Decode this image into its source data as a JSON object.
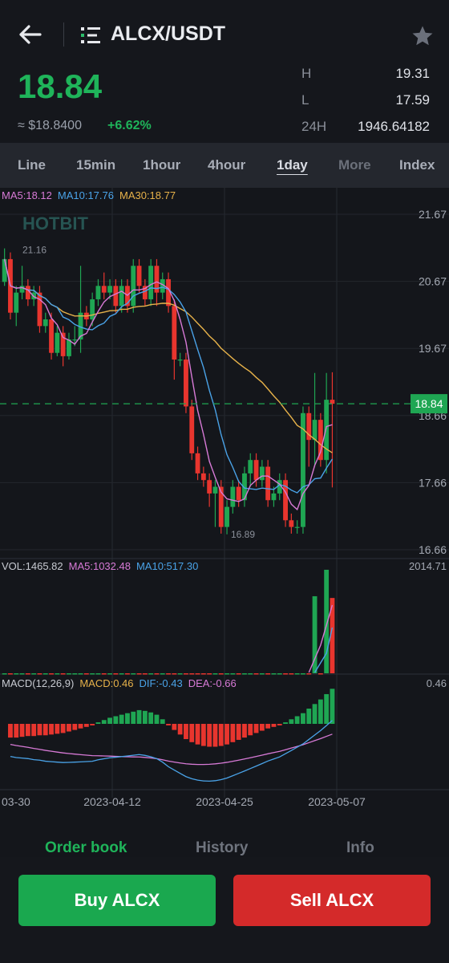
{
  "header": {
    "pair": "ALCX/USDT",
    "price": "18.84",
    "approx_usd": "≈ $18.8400",
    "change": "+6.62%",
    "stats": [
      {
        "label": "H",
        "value": "19.31"
      },
      {
        "label": "L",
        "value": "17.59"
      },
      {
        "label": "24H",
        "value": "1946.64182"
      }
    ]
  },
  "tabs": [
    {
      "label": "Line",
      "state": "normal"
    },
    {
      "label": "15min",
      "state": "normal"
    },
    {
      "label": "1hour",
      "state": "normal"
    },
    {
      "label": "4hour",
      "state": "normal"
    },
    {
      "label": "1day",
      "state": "active"
    },
    {
      "label": "More",
      "state": "dim"
    },
    {
      "label": "Index",
      "state": "normal"
    }
  ],
  "colors": {
    "up": "#1fa653",
    "down": "#e8352e",
    "ma5": "#d77ad6",
    "ma10": "#4aa3e8",
    "ma30": "#e7b24a",
    "accent": "#1fb45a"
  },
  "chart_data": {
    "type": "candlestick",
    "watermark": "HOTBIT",
    "ma_legend": {
      "ma5": "MA5:18.12",
      "ma10": "MA10:17.76",
      "ma30": "MA30:18.77"
    },
    "price_axis": [
      "21.67",
      "20.67",
      "19.67",
      "18.66",
      "17.66",
      "16.66"
    ],
    "ylim": [
      16.66,
      21.67
    ],
    "high_label": "21.16",
    "low_label": "16.89",
    "current_price_tag": "18.84",
    "candles": [
      {
        "o": 20.66,
        "c": 21.0,
        "h": 21.16,
        "l": 20.6
      },
      {
        "o": 21.0,
        "c": 20.2,
        "h": 21.1,
        "l": 20.1
      },
      {
        "o": 20.2,
        "c": 20.5,
        "h": 20.6,
        "l": 20.0
      },
      {
        "o": 20.5,
        "c": 20.6,
        "h": 20.9,
        "l": 20.4
      },
      {
        "o": 20.6,
        "c": 20.4,
        "h": 20.7,
        "l": 20.3
      },
      {
        "o": 20.4,
        "c": 20.5,
        "h": 20.6,
        "l": 20.3
      },
      {
        "o": 20.5,
        "c": 20.0,
        "h": 20.6,
        "l": 19.9
      },
      {
        "o": 20.0,
        "c": 20.1,
        "h": 20.2,
        "l": 19.9
      },
      {
        "o": 20.1,
        "c": 19.6,
        "h": 20.2,
        "l": 19.5
      },
      {
        "o": 19.6,
        "c": 19.9,
        "h": 20.0,
        "l": 19.55
      },
      {
        "o": 19.9,
        "c": 19.55,
        "h": 20.0,
        "l": 19.4
      },
      {
        "o": 19.55,
        "c": 19.8,
        "h": 19.9,
        "l": 19.5
      },
      {
        "o": 19.8,
        "c": 19.8,
        "h": 20.0,
        "l": 19.7
      },
      {
        "o": 19.8,
        "c": 20.2,
        "h": 20.9,
        "l": 19.6
      },
      {
        "o": 20.2,
        "c": 20.1,
        "h": 20.3,
        "l": 20.0
      },
      {
        "o": 20.1,
        "c": 20.4,
        "h": 20.5,
        "l": 20.0
      },
      {
        "o": 20.4,
        "c": 20.6,
        "h": 20.7,
        "l": 20.3
      },
      {
        "o": 20.6,
        "c": 20.5,
        "h": 20.8,
        "l": 20.4
      },
      {
        "o": 20.5,
        "c": 20.6,
        "h": 20.7,
        "l": 20.4
      },
      {
        "o": 20.6,
        "c": 20.3,
        "h": 20.7,
        "l": 20.2
      },
      {
        "o": 20.3,
        "c": 20.6,
        "h": 20.7,
        "l": 20.2
      },
      {
        "o": 20.6,
        "c": 20.3,
        "h": 20.7,
        "l": 20.2
      },
      {
        "o": 20.3,
        "c": 20.9,
        "h": 21.0,
        "l": 20.2
      },
      {
        "o": 20.9,
        "c": 20.6,
        "h": 21.0,
        "l": 20.5
      },
      {
        "o": 20.6,
        "c": 20.4,
        "h": 20.7,
        "l": 20.3
      },
      {
        "o": 20.4,
        "c": 20.9,
        "h": 21.0,
        "l": 20.3
      },
      {
        "o": 20.9,
        "c": 20.5,
        "h": 21.0,
        "l": 20.3
      },
      {
        "o": 20.5,
        "c": 20.7,
        "h": 20.8,
        "l": 20.4
      },
      {
        "o": 20.7,
        "c": 20.3,
        "h": 20.8,
        "l": 20.2
      },
      {
        "o": 20.3,
        "c": 19.5,
        "h": 20.4,
        "l": 19.2
      },
      {
        "o": 19.5,
        "c": 19.5,
        "h": 19.6,
        "l": 19.4
      },
      {
        "o": 19.5,
        "c": 18.8,
        "h": 19.6,
        "l": 18.7
      },
      {
        "o": 18.8,
        "c": 18.1,
        "h": 18.9,
        "l": 18.0
      },
      {
        "o": 18.1,
        "c": 17.8,
        "h": 18.2,
        "l": 17.7
      },
      {
        "o": 17.8,
        "c": 17.7,
        "h": 17.9,
        "l": 17.6
      },
      {
        "o": 17.7,
        "c": 17.5,
        "h": 17.8,
        "l": 17.3
      },
      {
        "o": 17.5,
        "c": 17.6,
        "h": 17.7,
        "l": 17.0
      },
      {
        "o": 17.6,
        "c": 17.0,
        "h": 17.7,
        "l": 16.9
      },
      {
        "o": 17.0,
        "c": 17.3,
        "h": 17.4,
        "l": 16.89
      },
      {
        "o": 17.3,
        "c": 17.6,
        "h": 17.7,
        "l": 17.2
      },
      {
        "o": 17.6,
        "c": 17.4,
        "h": 17.7,
        "l": 17.3
      },
      {
        "o": 17.4,
        "c": 17.8,
        "h": 17.9,
        "l": 17.3
      },
      {
        "o": 17.8,
        "c": 18.0,
        "h": 18.1,
        "l": 17.6
      },
      {
        "o": 18.0,
        "c": 17.7,
        "h": 18.1,
        "l": 17.6
      },
      {
        "o": 17.7,
        "c": 17.9,
        "h": 18.0,
        "l": 17.6
      },
      {
        "o": 17.9,
        "c": 17.4,
        "h": 18.0,
        "l": 17.3
      },
      {
        "o": 17.4,
        "c": 17.5,
        "h": 17.6,
        "l": 17.3
      },
      {
        "o": 17.5,
        "c": 17.7,
        "h": 17.8,
        "l": 17.4
      },
      {
        "o": 17.7,
        "c": 17.1,
        "h": 17.8,
        "l": 17.0
      },
      {
        "o": 17.1,
        "c": 17.0,
        "h": 17.2,
        "l": 16.9
      },
      {
        "o": 17.0,
        "c": 17.0,
        "h": 17.1,
        "l": 16.9
      },
      {
        "o": 17.0,
        "c": 18.7,
        "h": 18.8,
        "l": 16.9
      },
      {
        "o": 18.7,
        "c": 18.3,
        "h": 18.8,
        "l": 17.9
      },
      {
        "o": 18.3,
        "c": 18.6,
        "h": 19.3,
        "l": 17.9
      },
      {
        "o": 18.6,
        "c": 18.0,
        "h": 18.7,
        "l": 17.9
      },
      {
        "o": 18.0,
        "c": 18.9,
        "h": 19.3,
        "l": 17.8
      },
      {
        "o": 18.9,
        "c": 18.84,
        "h": 19.31,
        "l": 17.59
      }
    ],
    "volume": {
      "legend": {
        "vol": "VOL:1465.82",
        "ma5": "MA5:1032.48",
        "ma10": "MA10:517.30"
      },
      "max_label": "2014.71",
      "ylim": [
        0,
        2014.71
      ],
      "values": [
        0,
        0,
        0,
        0,
        0,
        0,
        0,
        0,
        0,
        0,
        0,
        0,
        0,
        0,
        0,
        0,
        0,
        0,
        0,
        0,
        0,
        0,
        0,
        0,
        0,
        0,
        0,
        0,
        0,
        0,
        0,
        0,
        0,
        0,
        0,
        0,
        0,
        0,
        0,
        0,
        0,
        0,
        0,
        0,
        0,
        0,
        0,
        0,
        0,
        0,
        0,
        0,
        0,
        1500,
        0,
        2014.71,
        1465.82
      ]
    },
    "macd": {
      "legend": {
        "label": "MACD(12,26,9)",
        "macd": "MACD:0.46",
        "dif": "DIF:-0.43",
        "dea": "DEA:-0.66"
      },
      "max_label": "0.46",
      "histogram": [
        -0.18,
        -0.18,
        -0.17,
        -0.16,
        -0.16,
        -0.15,
        -0.15,
        -0.14,
        -0.13,
        -0.12,
        -0.1,
        -0.08,
        -0.06,
        -0.04,
        -0.02,
        0.02,
        0.05,
        0.08,
        0.1,
        0.12,
        0.14,
        0.16,
        0.18,
        0.17,
        0.15,
        0.12,
        0.06,
        -0.02,
        -0.08,
        -0.14,
        -0.2,
        -0.24,
        -0.27,
        -0.29,
        -0.3,
        -0.3,
        -0.29,
        -0.27,
        -0.24,
        -0.21,
        -0.18,
        -0.15,
        -0.12,
        -0.09,
        -0.06,
        -0.04,
        -0.02,
        0.02,
        0.06,
        0.1,
        0.14,
        0.2,
        0.26,
        0.32,
        0.39,
        0.46
      ]
    },
    "x_labels": [
      "03-30",
      "2023-04-12",
      "2023-04-25",
      "2023-05-07"
    ]
  },
  "bottom_tabs": [
    "Order book",
    "History",
    "Info"
  ],
  "actions": {
    "buy": "Buy ALCX",
    "sell": "Sell ALCX"
  }
}
